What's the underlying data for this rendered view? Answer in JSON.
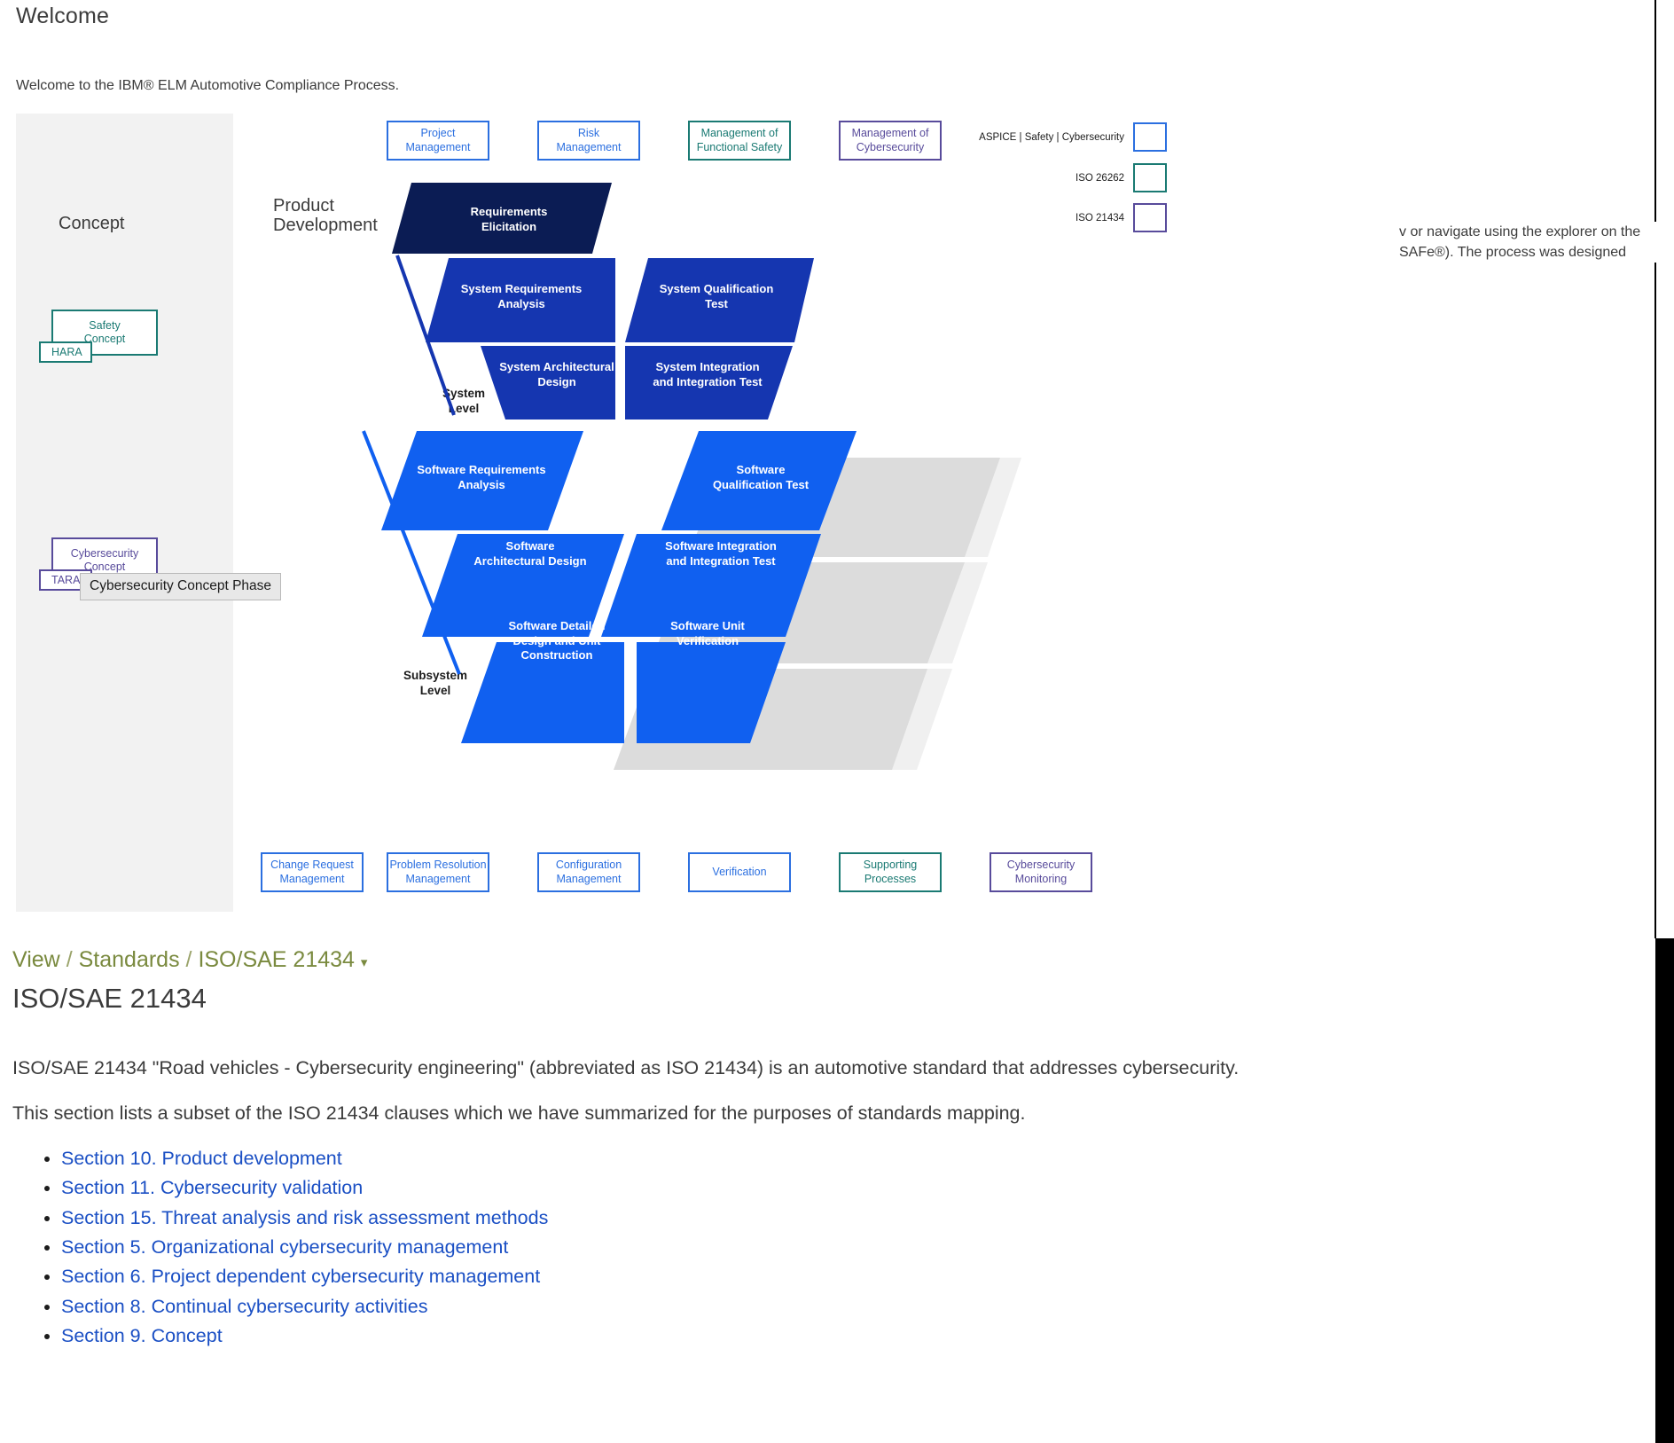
{
  "header": {
    "title": "Welcome",
    "intro": "Welcome to the IBM® ELM Automotive Compliance Process."
  },
  "diagram": {
    "concept_column_label": "Concept",
    "product_development_label": "Product\nDevelopment",
    "concept_phases": [
      {
        "name": "Safety Concept",
        "line1": "Safety",
        "line2": "Concept",
        "sub": "HARA",
        "color": "#1a7a73"
      },
      {
        "name": "Cybersecurity Concept",
        "line1": "Cybersecurity",
        "line2": "Concept",
        "sub": "TARA",
        "color": "#584b9b"
      }
    ],
    "tooltip": "Cybersecurity Concept Phase",
    "top_chips": [
      {
        "line1": "Project",
        "line2": "Management",
        "style": "blue"
      },
      {
        "line1": "Risk",
        "line2": "Management",
        "style": "blue"
      },
      {
        "line1": "Management of",
        "line2": "Functional Safety",
        "style": "teal"
      },
      {
        "line1": "Management of",
        "line2": "Cybersecurity",
        "style": "purple"
      }
    ],
    "bottom_chips": [
      {
        "line1": "Change Request",
        "line2": "Management",
        "style": "blue"
      },
      {
        "line1": "Problem Resolution",
        "line2": "Management",
        "style": "blue"
      },
      {
        "line1": "Configuration",
        "line2": "Management",
        "style": "blue"
      },
      {
        "line1": "Verification",
        "line2": "",
        "style": "blue"
      },
      {
        "line1": "Supporting",
        "line2": "Processes",
        "style": "teal"
      },
      {
        "line1": "Cybersecurity",
        "line2": "Monitoring",
        "style": "purple"
      }
    ],
    "legend": [
      {
        "label": "ASPICE | Safety | Cybersecurity",
        "color": "#2b6fe0",
        "style": "blue"
      },
      {
        "label": "ISO 26262",
        "color": "#1a7a73",
        "style": "teal"
      },
      {
        "label": "ISO 21434",
        "color": "#584b9b",
        "style": "purple"
      }
    ],
    "overlay_text_line1": "v or navigate using the explorer on the",
    "overlay_text_line2": "SAFe®). The process was designed",
    "levels": {
      "system": "System\nLevel",
      "subsystem": "Subsystem\nLevel"
    },
    "vmodel_cells": [
      {
        "id": "requirements-elicitation",
        "line1": "Requirements",
        "line2": "Elicitation",
        "fill": "#0b1c54"
      },
      {
        "id": "system-requirements-analysis",
        "line1": "System Requirements",
        "line2": "Analysis",
        "fill": "#1536b0"
      },
      {
        "id": "system-qualification-test",
        "line1": "System Qualification",
        "line2": "Test",
        "fill": "#1536b0"
      },
      {
        "id": "system-architectural-design",
        "line1": "System Architectural",
        "line2": "Design",
        "fill": "#1536b0"
      },
      {
        "id": "system-integration-and-integration-test",
        "line1": "System Integration",
        "line2": "and Integration Test",
        "fill": "#1536b0"
      },
      {
        "id": "software-requirements-analysis",
        "line1": "Software Requirements",
        "line2": "Analysis",
        "fill": "#1060f0"
      },
      {
        "id": "software-qualification-test",
        "line1": "Software",
        "line2": "Qualification Test",
        "fill": "#1060f0"
      },
      {
        "id": "software-architectural-design",
        "line1": "Software",
        "line2": "Architectural Design",
        "fill": "#1060f0"
      },
      {
        "id": "software-integration-and-integration-test",
        "line1": "Software Integration",
        "line2": "and Integration Test",
        "fill": "#1060f0"
      },
      {
        "id": "software-detailed-design-and-unit-construction",
        "line1": "Software Detailed",
        "line2": "Design and Unit",
        "line3": "Construction",
        "fill": "#1060f0"
      },
      {
        "id": "software-unit-verification",
        "line1": "Software Unit",
        "line2": "Verification",
        "fill": "#1060f0"
      }
    ]
  },
  "document": {
    "breadcrumb": {
      "root": "View",
      "level2": "Standards",
      "current": "ISO/SAE 21434",
      "caret": "▾"
    },
    "title": "ISO/SAE 21434",
    "paragraph1": "ISO/SAE 21434 \"Road vehicles - Cybersecurity engineering\" (abbreviated as ISO 21434) is an automotive standard that addresses cybersecurity.",
    "paragraph2": "This section lists a subset of the ISO 21434 clauses which we have summarized for the purposes of standards mapping.",
    "sections": [
      "Section 10. Product development",
      "Section 11. Cybersecurity validation",
      "Section 15. Threat analysis and risk assessment methods",
      "Section 5. Organizational cybersecurity management",
      "Section 6. Project dependent cybersecurity management",
      "Section 8. Continual cybersecurity activities",
      "Section 9. Concept"
    ]
  },
  "colors": {
    "blue": "#2b6fe0",
    "teal": "#1a7a73",
    "purple": "#584b9b",
    "link": "#1a4fc4",
    "breadcrumb": "#7a8a3f",
    "v_dark": "#0b1c54",
    "v_mid": "#1536b0",
    "v_light": "#1060f0"
  }
}
